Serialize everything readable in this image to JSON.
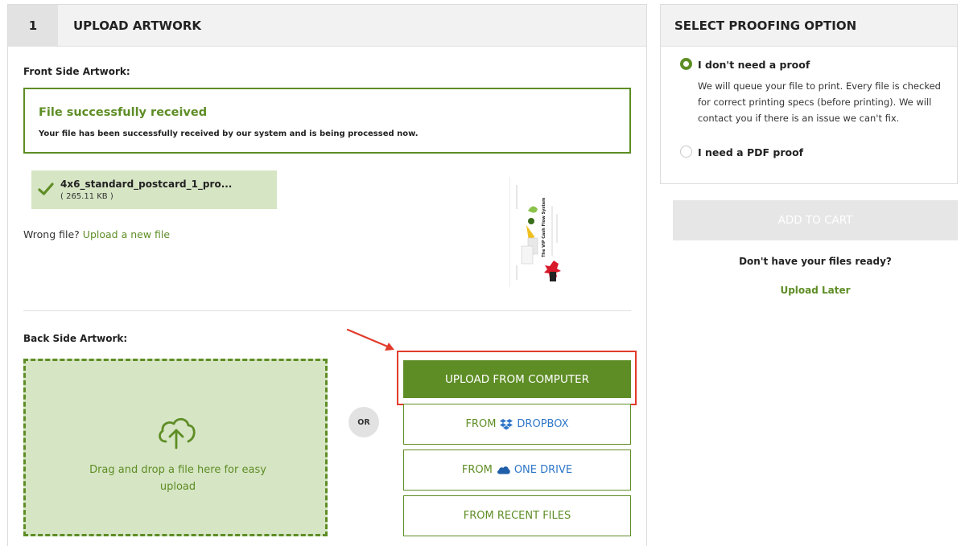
{
  "step": {
    "number": "1",
    "title": "UPLOAD ARTWORK"
  },
  "front": {
    "label": "Front Side Artwork:",
    "success_title": "File successfully received",
    "success_text": "Your file has been successfully received by our system and is being processed now.",
    "file_name": "4x6_standard_postcard_1_pro...",
    "file_size": "( 265.11 KB )",
    "wrong_file_text": "Wrong file?",
    "upload_new_link": "Upload a new file",
    "thumbnail_text": "The VIP Cash Flow System"
  },
  "back": {
    "label": "Back Side Artwork:",
    "dropzone_text": "Drag and drop a file here for easy upload",
    "or_label": "OR",
    "upload_computer": "UPLOAD FROM COMPUTER",
    "from_label": "FROM",
    "dropbox": "DROPBOX",
    "one_drive": "ONE DRIVE",
    "recent_files": "FROM RECENT FILES"
  },
  "proofing": {
    "title": "SELECT PROOFING OPTION",
    "options": [
      {
        "label": "I don't need a proof",
        "selected": true,
        "description": "We will queue your file to print. Every file is checked for correct printing specs (before printing). We will contact you if there is an issue we can't fix."
      },
      {
        "label": "I need a PDF proof",
        "selected": false
      }
    ]
  },
  "cart": {
    "add_to_cart": "ADD TO CART",
    "not_ready": "Don't have your files ready?",
    "upload_later": "Upload Later"
  },
  "colors": {
    "accent_green": "#5e8d25",
    "light_green": "#d6e5c4",
    "highlight_red": "#e23b2b",
    "link_blue": "#2f77c9",
    "disabled_gray": "#e6e6e6"
  }
}
